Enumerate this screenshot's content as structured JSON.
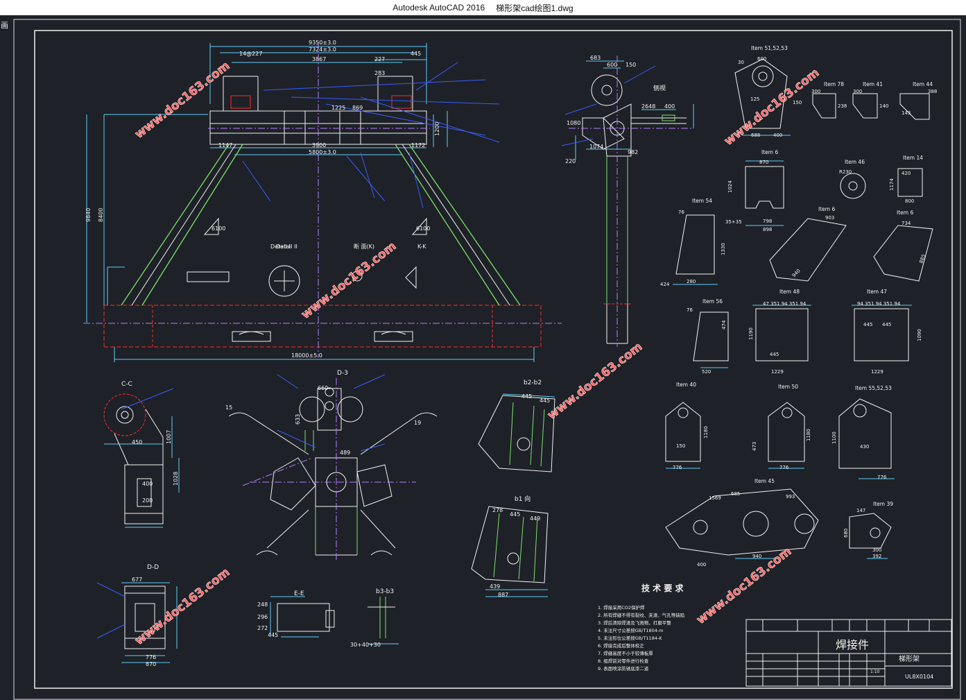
{
  "window": {
    "app_name": "Autodesk AutoCAD 2016",
    "file_name": "梯形架cad绘图1.dwg"
  },
  "corner_glyph": "画",
  "watermark": "www.doc163.com",
  "front_view": {
    "dims": {
      "d9350": "9350±3.0",
      "d7324": "7324±3.0",
      "d3867": "3867",
      "d227": "227",
      "d445": "445",
      "d14227": "14@227",
      "d283": "283",
      "d1147": "1147",
      "d3900": "3900",
      "d1172": "1172",
      "d5800": "5800±3.0",
      "d9840": "9840",
      "d8400": "8400",
      "d18000": "18000±5.0",
      "d869": "869",
      "d1225": "1225",
      "d1200": "1200",
      "d1178": "1178"
    },
    "labels": {
      "detail1": "Detail I",
      "detail2": "Detail II",
      "section_mark": "断 面(K)",
      "kk": "K-K",
      "slope_left": "6100",
      "slope_right": "6100"
    }
  },
  "side_view": {
    "dims": {
      "d683": "683",
      "d600": "600",
      "d150": "150",
      "d400": "400",
      "d240": "240",
      "d2648": "2648",
      "d1074": "1074",
      "d982": "982",
      "d1080": "1080",
      "d220": "220"
    },
    "label": "侧视"
  },
  "sections": {
    "cc": "C-C",
    "dd": "D-D",
    "ee": "E-E",
    "b3b3": "b3-b3",
    "b2b2": "b2-b2",
    "b1": "b1 向",
    "main_label": "D-3",
    "cc_dims": {
      "d450": "450",
      "d400": "400",
      "d200": "200",
      "d1028": "1028",
      "d1007": "1007"
    },
    "dd_dims": {
      "d677": "677",
      "d776": "776",
      "d870": "870"
    },
    "ee_dims": {
      "d248": "248",
      "d296": "296",
      "d272": "272",
      "d445": "445",
      "d30": "30+40+30"
    },
    "b2_dims": {
      "d445a": "445",
      "d445b": "445"
    },
    "b1_dims": {
      "d278": "278",
      "d445": "445",
      "d449": "449",
      "d439": "439",
      "d887": "887"
    },
    "main_dims": {
      "d660": "660",
      "d633": "633",
      "d489": "489",
      "d15": "15",
      "d19": "19"
    }
  },
  "items": {
    "i515253a": "Item 51,52,53",
    "i78": "Item 78",
    "i41": "Item 41",
    "i44": "Item 44",
    "i6a": "Item 6",
    "i46": "Item 46",
    "i14": "Item 14",
    "i54": "Item 54",
    "i6b": "Item 6",
    "i6c": "Item 6",
    "i56": "Item 56",
    "i48": "Item 48",
    "i47": "Item 47",
    "i40": "Item 40",
    "i50": "Item 50",
    "i555253": "Item 55,52,53",
    "i45": "Item 45",
    "i39": "Item 39"
  },
  "item_dims": {
    "i515253": {
      "d30": "30",
      "d600": "600",
      "d688": "688",
      "d400": "400",
      "d125": "125",
      "d150": "150"
    },
    "i78": {
      "d300": "300",
      "d238": "238"
    },
    "i41": {
      "d300": "300",
      "d140": "140"
    },
    "i44": {
      "d388": "388",
      "d143": "143"
    },
    "i6a": {
      "d870": "870",
      "d798": "798",
      "d898": "898",
      "d1024": "1024",
      "d3535": "35+35"
    },
    "i46": {
      "d8230": "R230"
    },
    "i14": {
      "d420": "420",
      "d800": "800",
      "d1174": "1174"
    },
    "i54": {
      "d76": "76",
      "d280": "280",
      "d1330": "1330",
      "d424": "424"
    },
    "i6b": {
      "d903": "903",
      "d940": "940"
    },
    "i6c": {
      "d734": "734",
      "d885": "885"
    },
    "i56": {
      "d76": "76",
      "d520": "520",
      "d474": "474"
    },
    "i48": {
      "d94": "47 351 94 351 94",
      "d445": "445",
      "d1190": "1190",
      "d1229": "1229"
    },
    "i47": {
      "d94": "94 351 94 351 94",
      "d445a": "445",
      "d445b": "445",
      "d1090": "1090",
      "d1229": "1229"
    },
    "i40": {
      "d776": "776",
      "d1180": "1180",
      "d150": "150"
    },
    "i50": {
      "d776": "776",
      "d1180": "1180",
      "d473": "473"
    },
    "i555253": {
      "d430": "430",
      "d776": "776",
      "d1100": "1100"
    },
    "i45": {
      "d685": "685",
      "d993": "993",
      "d940": "940",
      "d1569": "1569",
      "d400": "400"
    },
    "i39": {
      "d147": "147",
      "d300": "300",
      "d392": "392",
      "d680": "680"
    }
  },
  "tech_req": {
    "title": "技 术 要 求",
    "lines": [
      "1. 焊接采用CO2保护焊",
      "2. 所有焊缝不得有裂纹、夹渣、气孔等缺陷",
      "3. 焊后清除焊渣及飞溅物，打磨平整",
      "4. 未注尺寸公差按GB/T1804-m",
      "5. 未注形位公差按GB/T1184-K",
      "6. 焊接完成后整体校正",
      "7. 焊缝高度不小于较薄板厚",
      "8. 组焊前对零件进行检查",
      "9. 表面喷涂防锈底漆二道"
    ]
  },
  "title_block": {
    "part": "焊接件",
    "drawing_name": "梯形架",
    "drawing_no": "UL8X0104",
    "scale": "1:10"
  }
}
